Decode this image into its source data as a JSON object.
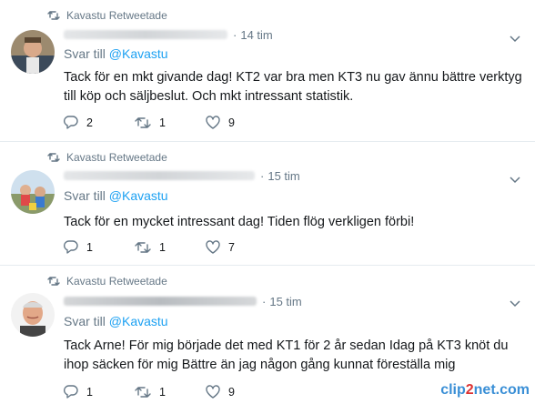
{
  "tweets": [
    {
      "retweet_label": "Kavastu Retweetade",
      "time": "14 tim",
      "reply_prefix": "Svar till",
      "reply_handle": "@Kavastu",
      "text": "Tack för en mkt givande dag! KT2 var bra men KT3 nu gav ännu bättre verktyg till köp och säljbeslut. Och mkt intressant statistik.",
      "replies": "2",
      "retweets": "1",
      "likes": "9"
    },
    {
      "retweet_label": "Kavastu Retweetade",
      "time": "15 tim",
      "reply_prefix": "Svar till",
      "reply_handle": "@Kavastu",
      "text": "Tack för en mycket intressant dag! Tiden flög verkligen förbi!",
      "replies": "1",
      "retweets": "1",
      "likes": "7"
    },
    {
      "retweet_label": "Kavastu Retweetade",
      "time": "15 tim",
      "reply_prefix": "Svar till",
      "reply_handle": "@Kavastu",
      "text": "Tack Arne! För mig började det med KT1 för 2 år sedan Idag på KT3 knöt du ihop säcken för mig Bättre än jag någon gång kunnat föreställa mig",
      "replies": "1",
      "retweets": "1",
      "likes": "9"
    }
  ],
  "separator": "·",
  "watermark": {
    "part1": "clip",
    "part2": "2",
    "part3": "net.com"
  },
  "colors": {
    "link": "#1da1f2",
    "muted": "#657786",
    "text": "#14171a",
    "divider": "#e6ecf0"
  }
}
